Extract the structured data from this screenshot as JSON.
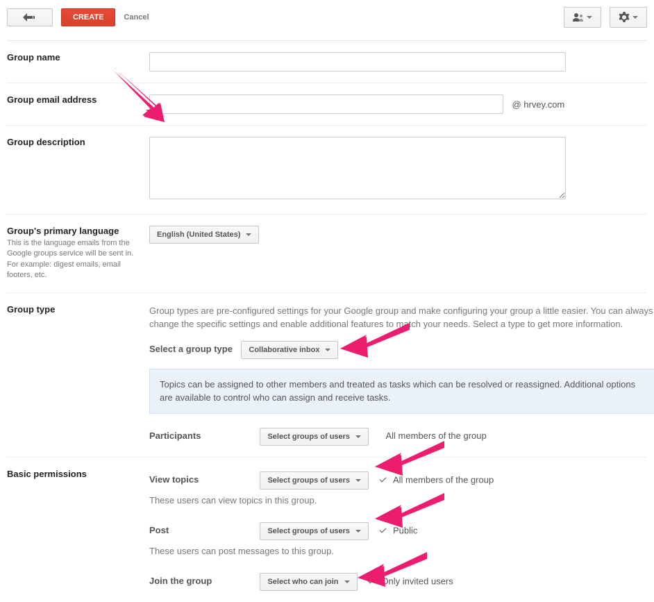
{
  "toolbar": {
    "create_label": "CREATE",
    "cancel_label": "Cancel"
  },
  "form": {
    "group_name": {
      "label": "Group name",
      "value": ""
    },
    "group_email": {
      "label": "Group email address",
      "value": "",
      "suffix": "@ hrvey.com"
    },
    "group_description": {
      "label": "Group description",
      "value": ""
    },
    "primary_language": {
      "label": "Group's primary language",
      "help": "This is the language emails from the Google groups service will be sent in. For example: digest emails, email footers, etc.",
      "selected": "English (United States)"
    },
    "group_type": {
      "label": "Group type",
      "description": "Group types are pre-configured settings for your Google group and make configuring your group a little easier. You can always change the specific settings and enable additional features to match your needs. Select a type to get more information.",
      "select_label": "Select a group type",
      "selected": "Collaborative inbox",
      "info": "Topics can be assigned to other members and treated as tasks which can be resolved or reassigned. Additional options are available to control who can assign and receive tasks.",
      "participants_label": "Participants",
      "participants_dropdown": "Select groups of users",
      "participants_summary": "All members of the group"
    },
    "permissions": {
      "label": "Basic permissions",
      "view_topics": {
        "label": "View topics",
        "dropdown": "Select groups of users",
        "summary": "All members of the group",
        "help": "These users can view topics in this group."
      },
      "post": {
        "label": "Post",
        "dropdown": "Select groups of users",
        "summary": "Public",
        "help": "These users can post messages to this group."
      },
      "join": {
        "label": "Join the group",
        "dropdown": "Select who can join",
        "summary": "Only invited users"
      }
    }
  }
}
